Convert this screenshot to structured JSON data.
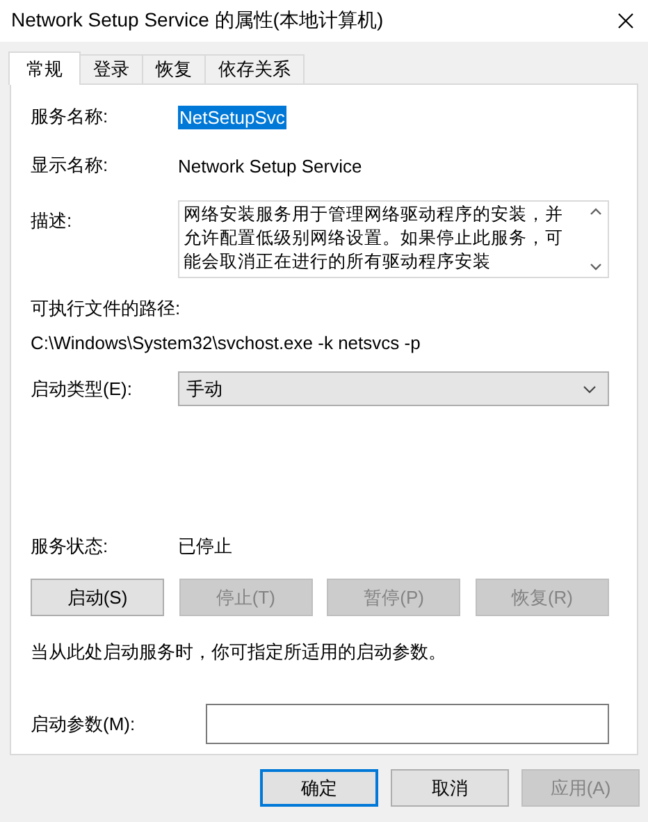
{
  "window": {
    "title": "Network Setup Service 的属性(本地计算机)"
  },
  "tabs": [
    {
      "label": "常规",
      "selected": true
    },
    {
      "label": "登录",
      "selected": false
    },
    {
      "label": "恢复",
      "selected": false
    },
    {
      "label": "依存关系",
      "selected": false
    }
  ],
  "service_name": {
    "label": "服务名称:",
    "value": "NetSetupSvc",
    "selected": true
  },
  "display_name": {
    "label": "显示名称:",
    "value": "Network Setup Service"
  },
  "description": {
    "label": "描述:",
    "value": "网络安装服务用于管理网络驱动程序的安装，并允许配置低级别网络设置。如果停止此服务，可能会取消正在进行的所有驱动程序安装"
  },
  "path": {
    "label": "可执行文件的路径:",
    "value": "C:\\Windows\\System32\\svchost.exe -k netsvcs -p"
  },
  "startup_type": {
    "label": "启动类型(E):",
    "value": "手动"
  },
  "status": {
    "label": "服务状态:",
    "value": "已停止"
  },
  "service_buttons": [
    {
      "label": "启动(S)",
      "disabled": false
    },
    {
      "label": "停止(T)",
      "disabled": true
    },
    {
      "label": "暂停(P)",
      "disabled": true
    },
    {
      "label": "恢复(R)",
      "disabled": true
    }
  ],
  "hint": "当从此处启动服务时，你可指定所适用的启动参数。",
  "parameters": {
    "label": "启动参数(M):"
  },
  "dialog_buttons": [
    {
      "label": "确定",
      "default": true,
      "disabled": false
    },
    {
      "label": "取消",
      "default": false,
      "disabled": false
    },
    {
      "label": "应用(A)",
      "default": false,
      "disabled": true
    }
  ]
}
